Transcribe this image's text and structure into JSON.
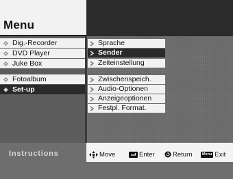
{
  "menu": {
    "title": "Menu"
  },
  "left_menu": {
    "items": [
      {
        "label": "Dig.-Recorder"
      },
      {
        "label": "DVD Player"
      },
      {
        "label": "Juke Box"
      },
      {
        "label": "Fotoalbum"
      },
      {
        "label": "Set-up",
        "selected": true
      }
    ]
  },
  "submenu": {
    "items": [
      {
        "label": "Sprache"
      },
      {
        "label": "Sender",
        "selected": true
      },
      {
        "label": "Zeiteinstellung"
      },
      {
        "label": "Zwischenspeich."
      },
      {
        "label": "Audio-Optionen"
      },
      {
        "label": "Anzeigeoptionen"
      },
      {
        "label": "Festpl. Format."
      }
    ]
  },
  "instructions": {
    "label": "Instructions",
    "move": "Move",
    "enter": "Enter",
    "return": "Return",
    "menu_key": "Menu",
    "exit": "Exit"
  },
  "icons": {
    "bullet": "diamond-bullet-icon",
    "sub_arrow": "chevron-right-icon",
    "move": "arrows-cross-icon",
    "enter": "enter-key-icon",
    "return": "return-circle-icon",
    "exit": "menu-key-icon"
  },
  "colors": {
    "panel_light": "#f1f1f1",
    "selected_bg": "#2a2a2a",
    "background": "#6a6a6a"
  }
}
